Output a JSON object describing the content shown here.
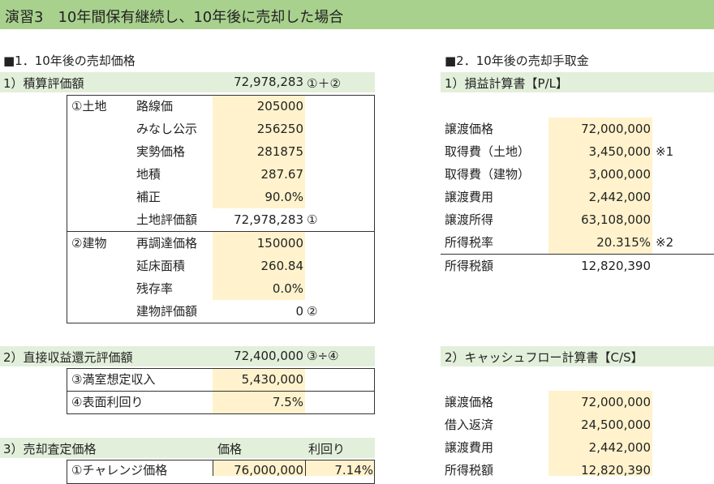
{
  "title": "演習3　10年間保有継続し、10年後に売却した場合",
  "left": {
    "section1": "■1．10年後の売却価格",
    "sub1": {
      "label": "1）積算評価額",
      "value": "72,978,283",
      "note": "①＋②",
      "land": {
        "group": "①土地",
        "rows": [
          {
            "label": "路線価",
            "value": "205000",
            "note": ""
          },
          {
            "label": "みなし公示",
            "value": "256250",
            "note": ""
          },
          {
            "label": "実勢価格",
            "value": "281875",
            "note": ""
          },
          {
            "label": "地積",
            "value": "287.67",
            "note": ""
          },
          {
            "label": "補正",
            "value": "90.0%",
            "note": ""
          },
          {
            "label": "土地評価額",
            "value": "72,978,283",
            "note": "①"
          }
        ]
      },
      "building": {
        "group": "②建物",
        "rows": [
          {
            "label": "再調達価格",
            "value": "150000",
            "note": ""
          },
          {
            "label": "延床面積",
            "value": "260.84",
            "note": ""
          },
          {
            "label": "残存率",
            "value": "0.0%",
            "note": ""
          },
          {
            "label": "建物評価額",
            "value": "0",
            "note": "②"
          }
        ]
      }
    },
    "sub2": {
      "label": "2）直接収益還元評価額",
      "value": "72,400,000",
      "note": "③÷④",
      "rows": [
        {
          "label": "③満室想定収入",
          "value": "5,430,000"
        },
        {
          "label": "④表面利回り",
          "value": "7.5%"
        }
      ]
    },
    "sub3": {
      "label": "3）売却査定価格",
      "col1": "価格",
      "col2": "利回り",
      "rows": [
        {
          "label": "①チャレンジ価格",
          "price": "76,000,000",
          "yield": "7.14%"
        }
      ]
    }
  },
  "right": {
    "section2": "■2．10年後の売却手取金",
    "pl": {
      "label": "1）損益計算書【P/L】",
      "rows": [
        {
          "label": "譲渡価格",
          "value": "72,000,000",
          "note": ""
        },
        {
          "label": "取得費（土地）",
          "value": "3,450,000",
          "note": "※1"
        },
        {
          "label": "取得費（建物）",
          "value": "3,000,000",
          "note": ""
        },
        {
          "label": "譲渡費用",
          "value": "2,442,000",
          "note": ""
        },
        {
          "label": "譲渡所得",
          "value": "63,108,000",
          "note": ""
        },
        {
          "label": "所得税率",
          "value": "20.315%",
          "note": "※2"
        }
      ],
      "total": {
        "label": "所得税額",
        "value": "12,820,390"
      }
    },
    "cs": {
      "label": "2）キャッシュフロー計算書【C/S】",
      "rows": [
        {
          "label": "譲渡価格",
          "value": "72,000,000"
        },
        {
          "label": "借入返済",
          "value": "24,500,000"
        },
        {
          "label": "譲渡費用",
          "value": "2,442,000"
        },
        {
          "label": "所得税額",
          "value": "12,820,390"
        }
      ]
    }
  }
}
